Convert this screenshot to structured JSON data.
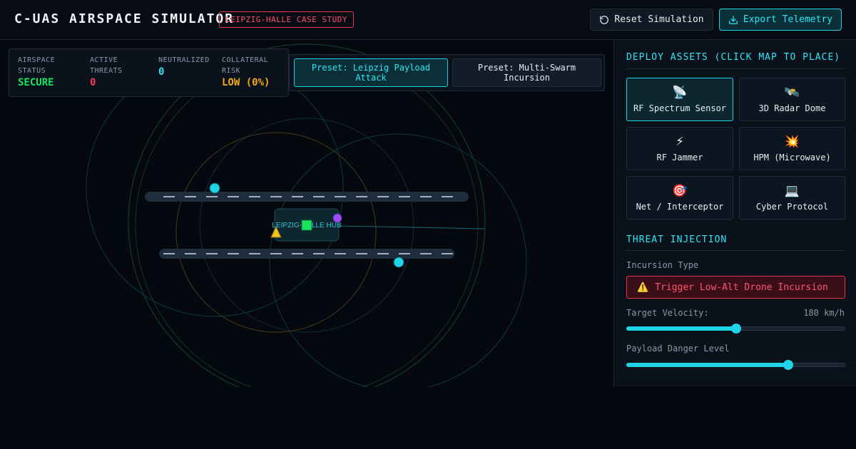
{
  "header": {
    "title": "C-UAS AIRSPACE SIMULATOR",
    "badge": "LEIPZIG-HALLE CASE STUDY",
    "reset_label": "Reset Simulation",
    "export_label": "Export Telemetry"
  },
  "stats": {
    "airspace_status": {
      "label": "AIRSPACE STATUS",
      "value": "SECURE",
      "color": "#19e35f"
    },
    "active_threats": {
      "label": "ACTIVE THREATS",
      "value": "0",
      "color": "#ff3358"
    },
    "neutralized": {
      "label": "NEUTRALIZED",
      "value": "0",
      "color": "#2ee6f5"
    },
    "collateral_risk": {
      "label": "COLLATERAL RISK",
      "value": "LOW (0%)",
      "color": "#f2a81d"
    }
  },
  "presets": {
    "leipzig": "Preset: Leipzig Payload Attack",
    "swarm": "Preset: Multi-Swarm Incursion"
  },
  "map": {
    "hub_label": "LEIPZIG-HALLE HUB"
  },
  "deploy": {
    "title": "DEPLOY ASSETS (CLICK MAP TO PLACE)",
    "assets": [
      {
        "label": "RF Spectrum Sensor",
        "icon": "📡",
        "icon_name": "satellite-antenna-icon",
        "active": true
      },
      {
        "label": "3D Radar Dome",
        "icon": "🛰️",
        "icon_name": "satellite-icon",
        "active": false
      },
      {
        "label": "RF Jammer",
        "icon": "⚡",
        "icon_name": "lightning-icon",
        "active": false
      },
      {
        "label": "HPM (Microwave)",
        "icon": "💥",
        "icon_name": "collision-icon",
        "active": false
      },
      {
        "label": "Net / Interceptor",
        "icon": "🎯",
        "icon_name": "target-icon",
        "active": false
      },
      {
        "label": "Cyber Protocol",
        "icon": "💻",
        "icon_name": "laptop-icon",
        "active": false
      }
    ]
  },
  "threat": {
    "title": "THREAT INJECTION",
    "incursion_label": "Incursion Type",
    "trigger_icon": "⚠️",
    "trigger_label": "Trigger Low-Alt Drone Incursion",
    "velocity_label": "Target Velocity:",
    "velocity_value": "180 km/h",
    "velocity_fraction": 0.5,
    "danger_label": "Payload Danger Level",
    "danger_fraction": 0.74
  },
  "colors": {
    "accent": "#1fd4e6",
    "danger": "#e5374f"
  }
}
